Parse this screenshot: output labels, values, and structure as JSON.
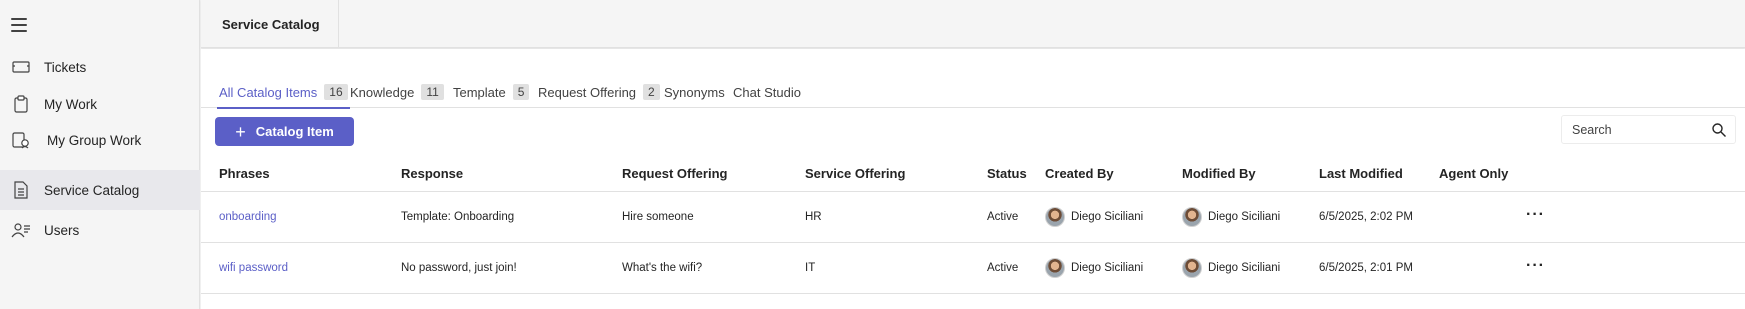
{
  "sidebar": {
    "items": [
      {
        "label": "Tickets",
        "icon": "ticket-icon"
      },
      {
        "label": "My Work",
        "icon": "clipboard-icon"
      },
      {
        "label": "My Group Work",
        "icon": "group-work-icon"
      },
      {
        "label": "Service Catalog",
        "icon": "document-icon",
        "active": true
      },
      {
        "label": "Users",
        "icon": "users-icon"
      }
    ]
  },
  "header": {
    "title": "Service Catalog"
  },
  "tabs": [
    {
      "label": "All Catalog Items",
      "count": "16",
      "active": true
    },
    {
      "label": "Knowledge",
      "count": "11"
    },
    {
      "label": "Template",
      "count": "5"
    },
    {
      "label": "Request Offering",
      "count": "2"
    },
    {
      "label": "Synonyms",
      "count": ""
    },
    {
      "label": "Chat Studio",
      "count": ""
    }
  ],
  "toolbar": {
    "add_label": "Catalog Item",
    "search_placeholder": "Search"
  },
  "table": {
    "columns": [
      "Phrases",
      "Response",
      "Request Offering",
      "Service Offering",
      "Status",
      "Created By",
      "Modified By",
      "Last Modified",
      "Agent Only"
    ],
    "rows": [
      {
        "phrase": "onboarding",
        "response": "Template: Onboarding",
        "request_offering": "Hire someone",
        "service_offering": "HR",
        "status": "Active",
        "created_by": "Diego Siciliani",
        "modified_by": "Diego Siciliani",
        "last_modified": "6/5/2025, 2:02 PM",
        "agent_only": ""
      },
      {
        "phrase": "wifi password",
        "response": "No password, just join!",
        "request_offering": "What's the wifi?",
        "service_offering": "IT",
        "status": "Active",
        "created_by": "Diego Siciliani",
        "modified_by": "Diego Siciliani",
        "last_modified": "6/5/2025, 2:01 PM",
        "agent_only": ""
      }
    ]
  },
  "colors": {
    "accent": "#5b5fc7"
  }
}
